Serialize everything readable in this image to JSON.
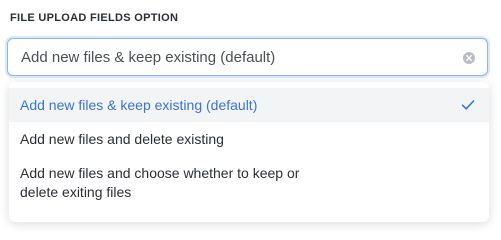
{
  "field": {
    "label": "FILE UPLOAD FIELDS OPTION",
    "selected_value": "Add new files & keep existing (default)",
    "clear_icon": "clear-circle-icon"
  },
  "dropdown": {
    "options": [
      {
        "label": "Add new files & keep existing (default)",
        "selected": true
      },
      {
        "label": "Add new files and delete existing",
        "selected": false
      },
      {
        "label": "Add new files and choose whether to keep or",
        "label_line2": "delete exiting files",
        "selected": false
      }
    ],
    "selected_icon": "checkmark-icon"
  },
  "colors": {
    "accent": "#3b73d6",
    "focus_border": "#8fb4ec",
    "selected_bg": "#f2f4f6",
    "text": "#2a2f36"
  }
}
